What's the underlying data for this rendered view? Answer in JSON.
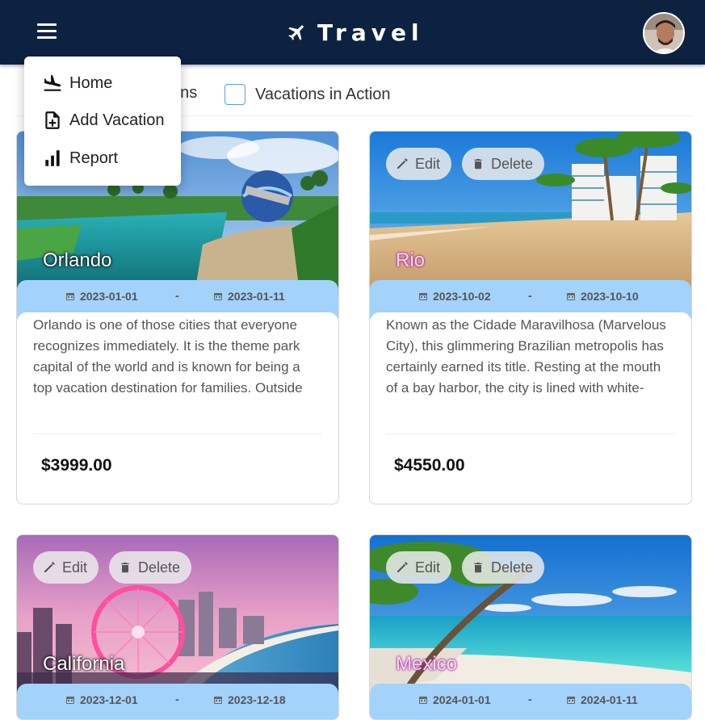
{
  "app": {
    "title": "Travel"
  },
  "menu": {
    "items": [
      {
        "label": "Home",
        "icon": "flight-land-icon"
      },
      {
        "label": "Add Vacation",
        "icon": "add-file-icon"
      },
      {
        "label": "Report",
        "icon": "bar-chart-icon"
      }
    ]
  },
  "filters": {
    "followed_partial": "ons",
    "in_action_label": "Vacations in Action"
  },
  "actions": {
    "edit_label": "Edit",
    "delete_label": "Delete"
  },
  "vacations": [
    {
      "destination": "Orlando",
      "start": "2023-01-01",
      "separator": "-",
      "end": "2023-01-11",
      "description": "Orlando is one of those cities that everyone recognizes immediately. It is the theme park capital of the world and is known for being a top vacation destination for families. Outside",
      "price": "$3999.00"
    },
    {
      "destination": "Rio",
      "start": "2023-10-02",
      "separator": "-",
      "end": "2023-10-10",
      "description": "Known as the Cidade Maravilhosa (Marvelous City), this glimmering Brazilian metropolis has certainly earned its title. Resting at the mouth of a bay harbor, the city is lined with white-",
      "price": "$4550.00"
    },
    {
      "destination": "California",
      "start": "2023-12-01",
      "separator": "-",
      "end": "2023-12-18"
    },
    {
      "destination": "Mexico",
      "start": "2024-01-01",
      "separator": "-",
      "end": "2024-01-11"
    }
  ],
  "colors": {
    "appbar": "#0c2240",
    "date_strip": "#a3d2fb",
    "checkbox_border": "#5aa0d8"
  }
}
